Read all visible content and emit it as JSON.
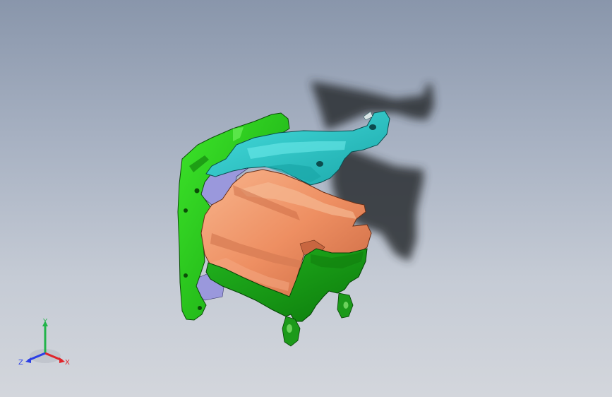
{
  "viewport": {
    "background_top": "#8996ab",
    "background_bottom": "#d3d6dc"
  },
  "model": {
    "parts": [
      {
        "name": "mounting-bracket",
        "color": "#22c814"
      },
      {
        "name": "upper-arm",
        "color": "#2ec8c8"
      },
      {
        "name": "reinforcement-panel",
        "color": "#f09a72"
      },
      {
        "name": "lower-channel",
        "color": "#1fa01c"
      },
      {
        "name": "inner-plate",
        "color": "#8c8cd6"
      }
    ],
    "shadow_color": "#2a2d33"
  },
  "triad": {
    "x_label": "X",
    "y_label": "Y",
    "z_label": "Z",
    "x_color": "#e0242a",
    "y_color": "#22b44a",
    "z_color": "#2a3ee6"
  }
}
